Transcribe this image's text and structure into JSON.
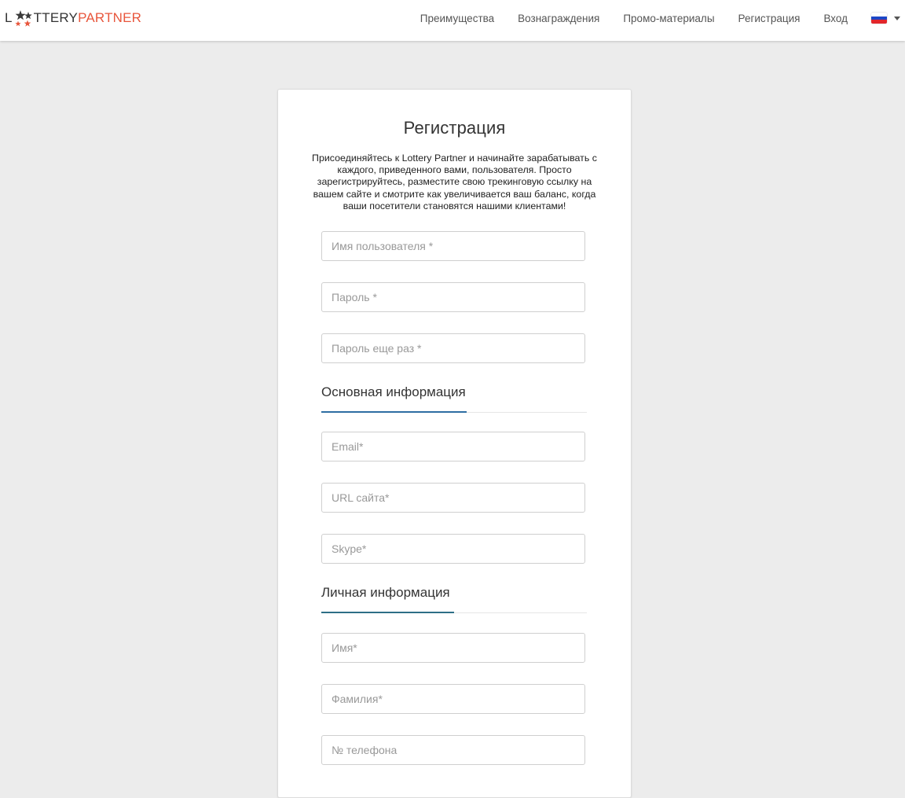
{
  "brand": {
    "logo_l": "L",
    "logo_ttery": "TTERY",
    "logo_partner": "PARTNER",
    "text_color": "#333333",
    "partner_color": "#e8563c",
    "star_colors": [
      "#3a3a3a",
      "#e8563c"
    ]
  },
  "nav": {
    "items": [
      {
        "label": "Преимущества"
      },
      {
        "label": "Вознаграждения"
      },
      {
        "label": "Промо-материалы"
      },
      {
        "label": "Регистрация"
      },
      {
        "label": "Вход"
      }
    ],
    "language_flag": {
      "icon": "russia-flag-icon",
      "colors": [
        "#ffffff",
        "#1c47c6",
        "#e2262b"
      ]
    }
  },
  "form": {
    "title": "Регистрация",
    "description": "Присоединяйтесь к Lottery Partner и начинайте зарабатывать с каждого, приведенного вами, пользователя. Просто зарегистрируйтесь, разместите свою трекинговую ссылку на вашем сайте и смотрите как увеличивается ваш баланс, когда ваши посетители становятся нашими клиентами!",
    "account_fields": {
      "username_placeholder": "Имя пользователя *",
      "password_placeholder": "Пароль *",
      "password_repeat_placeholder": "Пароль еще раз *"
    },
    "basic_info": {
      "title": "Основная информация",
      "accent_color": "#2e6ea3",
      "email_placeholder": "Email*",
      "url_placeholder": "URL сайта*",
      "skype_placeholder": "Skype*"
    },
    "personal_info": {
      "title": "Личная информация",
      "accent_color": "#2e6f86",
      "first_name_placeholder": "Имя*",
      "last_name_placeholder": "Фамилия*",
      "phone_placeholder": "№ телефона"
    }
  }
}
